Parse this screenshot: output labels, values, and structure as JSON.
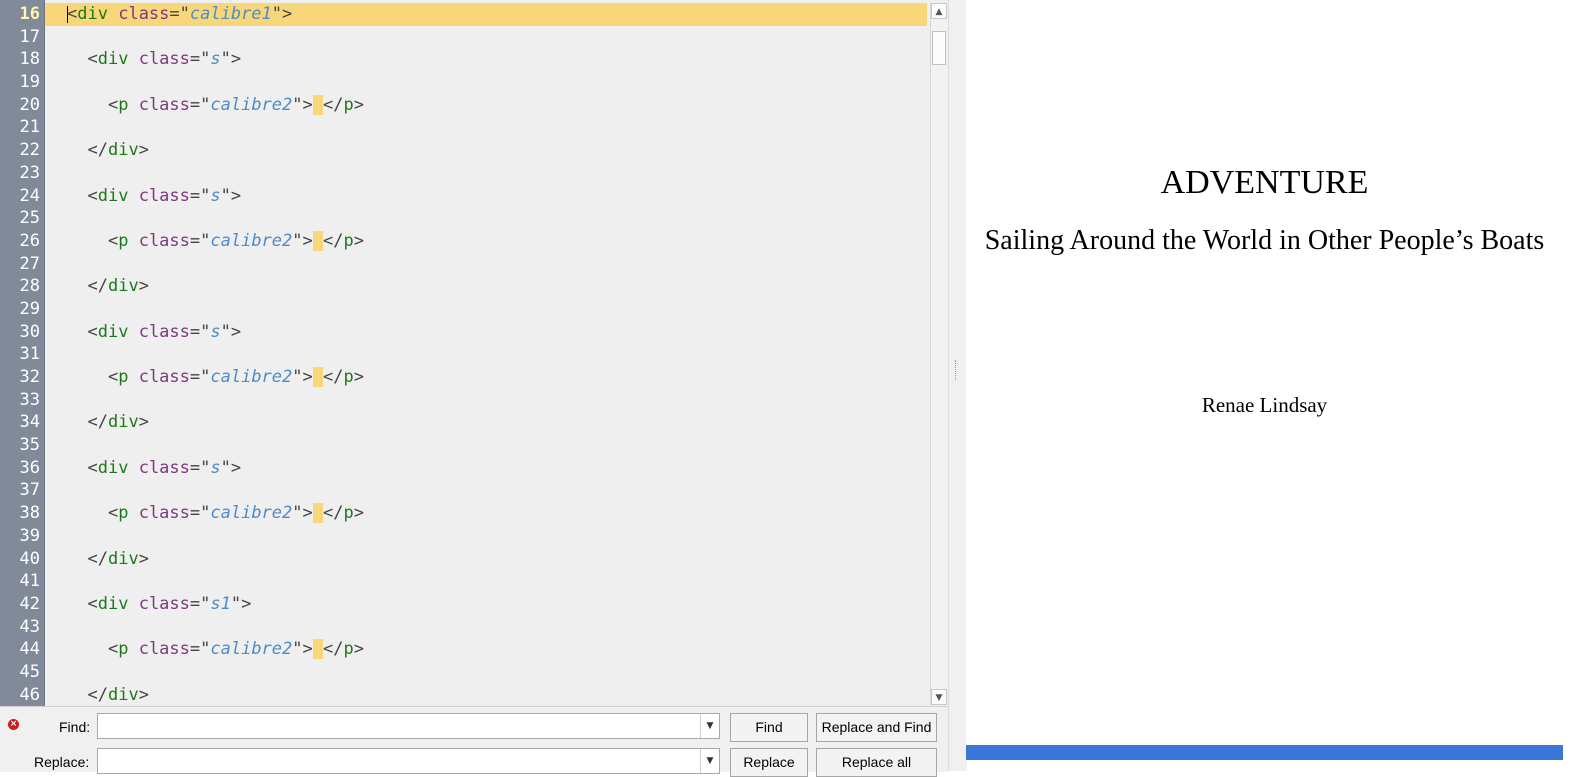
{
  "editor": {
    "current_line": "16",
    "lines": [
      {
        "n": "16",
        "tokens": [
          [
            "pun",
            "<"
          ],
          [
            "tag",
            "div"
          ],
          [
            "pun",
            " "
          ],
          [
            "attr",
            "class"
          ],
          [
            "pun",
            "=\""
          ],
          [
            "val",
            "calibre1"
          ],
          [
            "pun",
            "\">"
          ]
        ],
        "indent": "",
        "current": true
      },
      {
        "n": "17",
        "tokens": [],
        "indent": ""
      },
      {
        "n": "18",
        "tokens": [
          [
            "pun",
            "<"
          ],
          [
            "tag",
            "div"
          ],
          [
            "pun",
            " "
          ],
          [
            "attr",
            "class"
          ],
          [
            "pun",
            "=\""
          ],
          [
            "val",
            "s"
          ],
          [
            "pun",
            "\">"
          ]
        ],
        "indent": "  "
      },
      {
        "n": "19",
        "tokens": [],
        "indent": ""
      },
      {
        "n": "20",
        "tokens": [
          [
            "pun",
            "<"
          ],
          [
            "tag",
            "p"
          ],
          [
            "pun",
            " "
          ],
          [
            "attr",
            "class"
          ],
          [
            "pun",
            "=\""
          ],
          [
            "val",
            "calibre2"
          ],
          [
            "pun",
            "\">"
          ],
          [
            "mark",
            "_"
          ],
          [
            "pun",
            "</"
          ],
          [
            "tag",
            "p"
          ],
          [
            "pun",
            ">"
          ]
        ],
        "indent": "    "
      },
      {
        "n": "21",
        "tokens": [],
        "indent": ""
      },
      {
        "n": "22",
        "tokens": [
          [
            "pun",
            "</"
          ],
          [
            "tag",
            "div"
          ],
          [
            "pun",
            ">"
          ]
        ],
        "indent": "  "
      },
      {
        "n": "23",
        "tokens": [],
        "indent": ""
      },
      {
        "n": "24",
        "tokens": [
          [
            "pun",
            "<"
          ],
          [
            "tag",
            "div"
          ],
          [
            "pun",
            " "
          ],
          [
            "attr",
            "class"
          ],
          [
            "pun",
            "=\""
          ],
          [
            "val",
            "s"
          ],
          [
            "pun",
            "\">"
          ]
        ],
        "indent": "  "
      },
      {
        "n": "25",
        "tokens": [],
        "indent": ""
      },
      {
        "n": "26",
        "tokens": [
          [
            "pun",
            "<"
          ],
          [
            "tag",
            "p"
          ],
          [
            "pun",
            " "
          ],
          [
            "attr",
            "class"
          ],
          [
            "pun",
            "=\""
          ],
          [
            "val",
            "calibre2"
          ],
          [
            "pun",
            "\">"
          ],
          [
            "mark",
            "_"
          ],
          [
            "pun",
            "</"
          ],
          [
            "tag",
            "p"
          ],
          [
            "pun",
            ">"
          ]
        ],
        "indent": "    "
      },
      {
        "n": "27",
        "tokens": [],
        "indent": ""
      },
      {
        "n": "28",
        "tokens": [
          [
            "pun",
            "</"
          ],
          [
            "tag",
            "div"
          ],
          [
            "pun",
            ">"
          ]
        ],
        "indent": "  "
      },
      {
        "n": "29",
        "tokens": [],
        "indent": ""
      },
      {
        "n": "30",
        "tokens": [
          [
            "pun",
            "<"
          ],
          [
            "tag",
            "div"
          ],
          [
            "pun",
            " "
          ],
          [
            "attr",
            "class"
          ],
          [
            "pun",
            "=\""
          ],
          [
            "val",
            "s"
          ],
          [
            "pun",
            "\">"
          ]
        ],
        "indent": "  "
      },
      {
        "n": "31",
        "tokens": [],
        "indent": ""
      },
      {
        "n": "32",
        "tokens": [
          [
            "pun",
            "<"
          ],
          [
            "tag",
            "p"
          ],
          [
            "pun",
            " "
          ],
          [
            "attr",
            "class"
          ],
          [
            "pun",
            "=\""
          ],
          [
            "val",
            "calibre2"
          ],
          [
            "pun",
            "\">"
          ],
          [
            "mark",
            "_"
          ],
          [
            "pun",
            "</"
          ],
          [
            "tag",
            "p"
          ],
          [
            "pun",
            ">"
          ]
        ],
        "indent": "    "
      },
      {
        "n": "33",
        "tokens": [],
        "indent": ""
      },
      {
        "n": "34",
        "tokens": [
          [
            "pun",
            "</"
          ],
          [
            "tag",
            "div"
          ],
          [
            "pun",
            ">"
          ]
        ],
        "indent": "  "
      },
      {
        "n": "35",
        "tokens": [],
        "indent": ""
      },
      {
        "n": "36",
        "tokens": [
          [
            "pun",
            "<"
          ],
          [
            "tag",
            "div"
          ],
          [
            "pun",
            " "
          ],
          [
            "attr",
            "class"
          ],
          [
            "pun",
            "=\""
          ],
          [
            "val",
            "s"
          ],
          [
            "pun",
            "\">"
          ]
        ],
        "indent": "  "
      },
      {
        "n": "37",
        "tokens": [],
        "indent": ""
      },
      {
        "n": "38",
        "tokens": [
          [
            "pun",
            "<"
          ],
          [
            "tag",
            "p"
          ],
          [
            "pun",
            " "
          ],
          [
            "attr",
            "class"
          ],
          [
            "pun",
            "=\""
          ],
          [
            "val",
            "calibre2"
          ],
          [
            "pun",
            "\">"
          ],
          [
            "mark",
            "_"
          ],
          [
            "pun",
            "</"
          ],
          [
            "tag",
            "p"
          ],
          [
            "pun",
            ">"
          ]
        ],
        "indent": "    "
      },
      {
        "n": "39",
        "tokens": [],
        "indent": ""
      },
      {
        "n": "40",
        "tokens": [
          [
            "pun",
            "</"
          ],
          [
            "tag",
            "div"
          ],
          [
            "pun",
            ">"
          ]
        ],
        "indent": "  "
      },
      {
        "n": "41",
        "tokens": [],
        "indent": ""
      },
      {
        "n": "42",
        "tokens": [
          [
            "pun",
            "<"
          ],
          [
            "tag",
            "div"
          ],
          [
            "pun",
            " "
          ],
          [
            "attr",
            "class"
          ],
          [
            "pun",
            "=\""
          ],
          [
            "val",
            "s1"
          ],
          [
            "pun",
            "\">"
          ]
        ],
        "indent": "  "
      },
      {
        "n": "43",
        "tokens": [],
        "indent": ""
      },
      {
        "n": "44",
        "tokens": [
          [
            "pun",
            "<"
          ],
          [
            "tag",
            "p"
          ],
          [
            "pun",
            " "
          ],
          [
            "attr",
            "class"
          ],
          [
            "pun",
            "=\""
          ],
          [
            "val",
            "calibre2"
          ],
          [
            "pun",
            "\">"
          ],
          [
            "mark",
            "_"
          ],
          [
            "pun",
            "</"
          ],
          [
            "tag",
            "p"
          ],
          [
            "pun",
            ">"
          ]
        ],
        "indent": "    "
      },
      {
        "n": "45",
        "tokens": [],
        "indent": ""
      },
      {
        "n": "46",
        "tokens": [
          [
            "pun",
            "</"
          ],
          [
            "tag",
            "div"
          ],
          [
            "pun",
            ">"
          ]
        ],
        "indent": "  "
      }
    ]
  },
  "findbar": {
    "find_label": "Find:",
    "replace_label": "Replace:",
    "find_value": "",
    "replace_value": "",
    "find_button": "Find",
    "replace_find_button": "Replace and Find",
    "replace_button": "Replace",
    "replace_all_button": "Replace all"
  },
  "preview": {
    "title": "ADVENTURE",
    "subtitle": "Sailing Around the World in Other People’s Boats",
    "author": "Renae Lindsay"
  },
  "colors": {
    "current_line": "#f7d779",
    "gutter": "#808a98",
    "tag": "#1a7a1a",
    "attr": "#7d3a7d",
    "value": "#4d8cc6",
    "preview_bar": "#3a76d8"
  },
  "icons": {
    "close": "close-icon",
    "scroll_up": "scroll-up-arrow-icon",
    "scroll_down": "scroll-down-arrow-icon",
    "dropdown": "chevron-down-icon"
  }
}
